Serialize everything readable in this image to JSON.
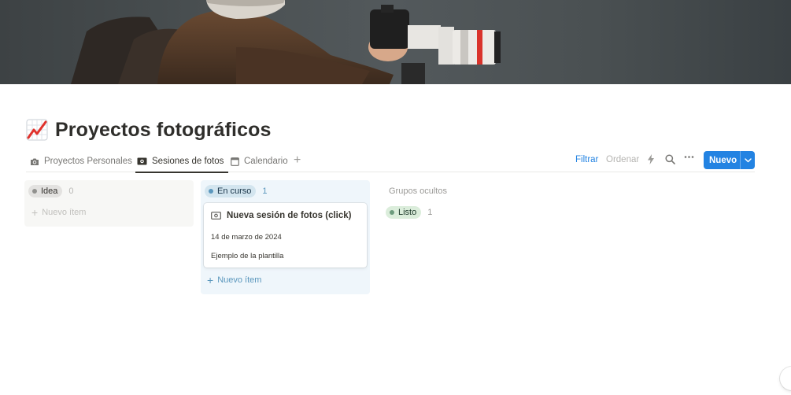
{
  "page": {
    "title": "Proyectos fotográficos",
    "title_icon": "chart-increasing-icon"
  },
  "tabs": [
    {
      "label": "Proyectos Personales",
      "icon": "camera-icon",
      "active": false
    },
    {
      "label": "Sesiones de fotos",
      "icon": "money-bill-icon",
      "active": true
    },
    {
      "label": "Calendario",
      "icon": "calendar-icon",
      "active": false
    }
  ],
  "toolbar": {
    "filter_label": "Filtrar",
    "sort_label": "Ordenar",
    "new_label": "Nuevo"
  },
  "board": {
    "groups": [
      {
        "label": "Idea",
        "count": "0",
        "add_label": "Nuevo ítem"
      },
      {
        "label": "En curso",
        "count": "1",
        "add_label": "Nuevo ítem",
        "cards": [
          {
            "title": "Nueva sesión de fotos (click)",
            "date": "14 de marzo de 2024",
            "description": "Ejemplo de la plantilla"
          }
        ]
      }
    ],
    "hidden_groups_label": "Grupos ocultos",
    "hidden_groups": [
      {
        "label": "Listo",
        "count": "1"
      }
    ]
  },
  "colors": {
    "accent": "#2383e2",
    "idea_pill": "#e3e2e0",
    "en_curso_pill": "#d3e5ef",
    "listo_pill": "#dbeddb"
  }
}
